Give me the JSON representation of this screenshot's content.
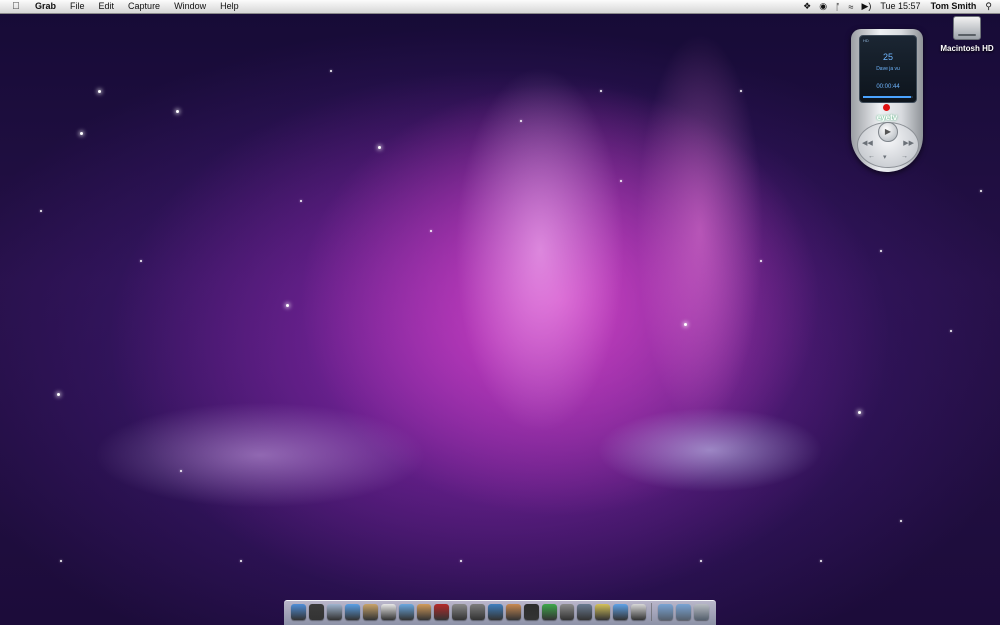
{
  "menubar": {
    "apple_icon": "apple-icon",
    "app_name": "Grab",
    "menus": [
      "File",
      "Edit",
      "Capture",
      "Window",
      "Help"
    ],
    "status_icons": [
      "dropbox-icon",
      "evernote-icon",
      "bluetooth-icon",
      "wifi-icon",
      "volume-icon"
    ],
    "clock": "Tue 15:57",
    "user": "Tom Smith",
    "search_icon": "spotlight-search-icon"
  },
  "desktop": {
    "icons": [
      {
        "label": "Macintosh HD",
        "icon": "hard-drive-icon"
      }
    ]
  },
  "eyetv_remote": {
    "display_top": "HD",
    "channel": "25",
    "program": "Dave ja vu",
    "time": "00:00:44",
    "brand": "eyetv",
    "progress": 0.95
  },
  "dock": {
    "apps": [
      {
        "name": "finder",
        "color": "#4f8ed8"
      },
      {
        "name": "dashboard",
        "color": "#3b3b3b"
      },
      {
        "name": "mail",
        "color": "#9fb4cf"
      },
      {
        "name": "safari",
        "color": "#5aa0e6"
      },
      {
        "name": "address-book",
        "color": "#c9a36a"
      },
      {
        "name": "ical",
        "color": "#e8e8e8"
      },
      {
        "name": "itunes",
        "color": "#6aa8e0"
      },
      {
        "name": "iphoto",
        "color": "#d29b5a"
      },
      {
        "name": "photo-booth",
        "color": "#b42a2a"
      },
      {
        "name": "imovie",
        "color": "#8a8a8a"
      },
      {
        "name": "script-editor",
        "color": "#7d7d7d"
      },
      {
        "name": "network-utility",
        "color": "#3f7fbf"
      },
      {
        "name": "preview",
        "color": "#c98a52"
      },
      {
        "name": "terminal",
        "color": "#2c2c2c"
      },
      {
        "name": "activity-monitor",
        "color": "#3ea84a"
      },
      {
        "name": "system-preferences",
        "color": "#8c8c8c"
      },
      {
        "name": "grab",
        "color": "#6a7c92"
      },
      {
        "name": "stickies",
        "color": "#d4c25a"
      },
      {
        "name": "ichat",
        "color": "#5ea2e8"
      },
      {
        "name": "calendar",
        "color": "#d8d8d8"
      }
    ],
    "folders": [
      {
        "name": "applications-folder",
        "color": "#7aa4d4"
      },
      {
        "name": "documents-folder",
        "color": "#7aa4d4"
      },
      {
        "name": "trash",
        "color": "#b8bcc2"
      }
    ]
  }
}
